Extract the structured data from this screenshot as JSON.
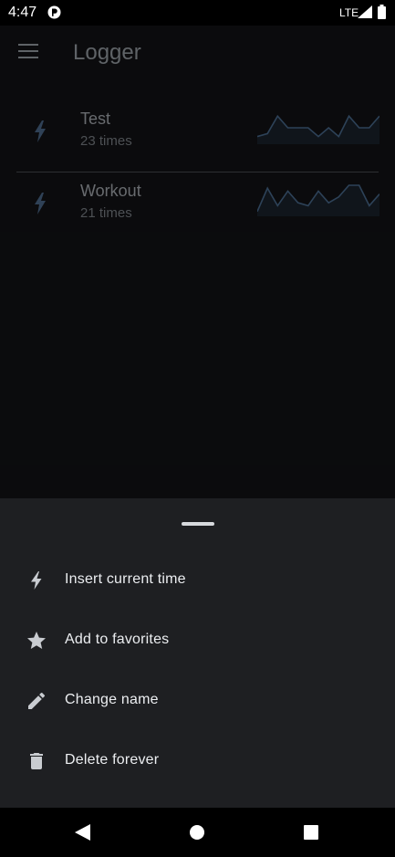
{
  "status_bar": {
    "time": "4:47",
    "network": "LTE"
  },
  "app": {
    "title": "Logger",
    "loggers": [
      {
        "name": "Test",
        "count_text": "23 times",
        "sparkline": [
          0.2,
          0.3,
          0.9,
          0.5,
          0.5,
          0.5,
          0.2,
          0.5,
          0.2,
          0.9,
          0.5,
          0.5,
          0.9
        ]
      },
      {
        "name": "Workout",
        "count_text": "21 times",
        "sparkline": [
          0.1,
          0.9,
          0.3,
          0.8,
          0.4,
          0.3,
          0.8,
          0.4,
          0.6,
          1.0,
          1.0,
          0.3,
          0.7
        ]
      }
    ]
  },
  "sheet": {
    "items": [
      {
        "label": "Insert current time",
        "icon": "bolt-icon"
      },
      {
        "label": "Add to favorites",
        "icon": "star-icon"
      },
      {
        "label": "Change name",
        "icon": "pencil-icon"
      },
      {
        "label": "Delete forever",
        "icon": "trash-icon"
      }
    ]
  },
  "colors": {
    "accent": "#4a6b8f",
    "sheet_bg": "#1e1f22",
    "app_bg": "#121315"
  }
}
